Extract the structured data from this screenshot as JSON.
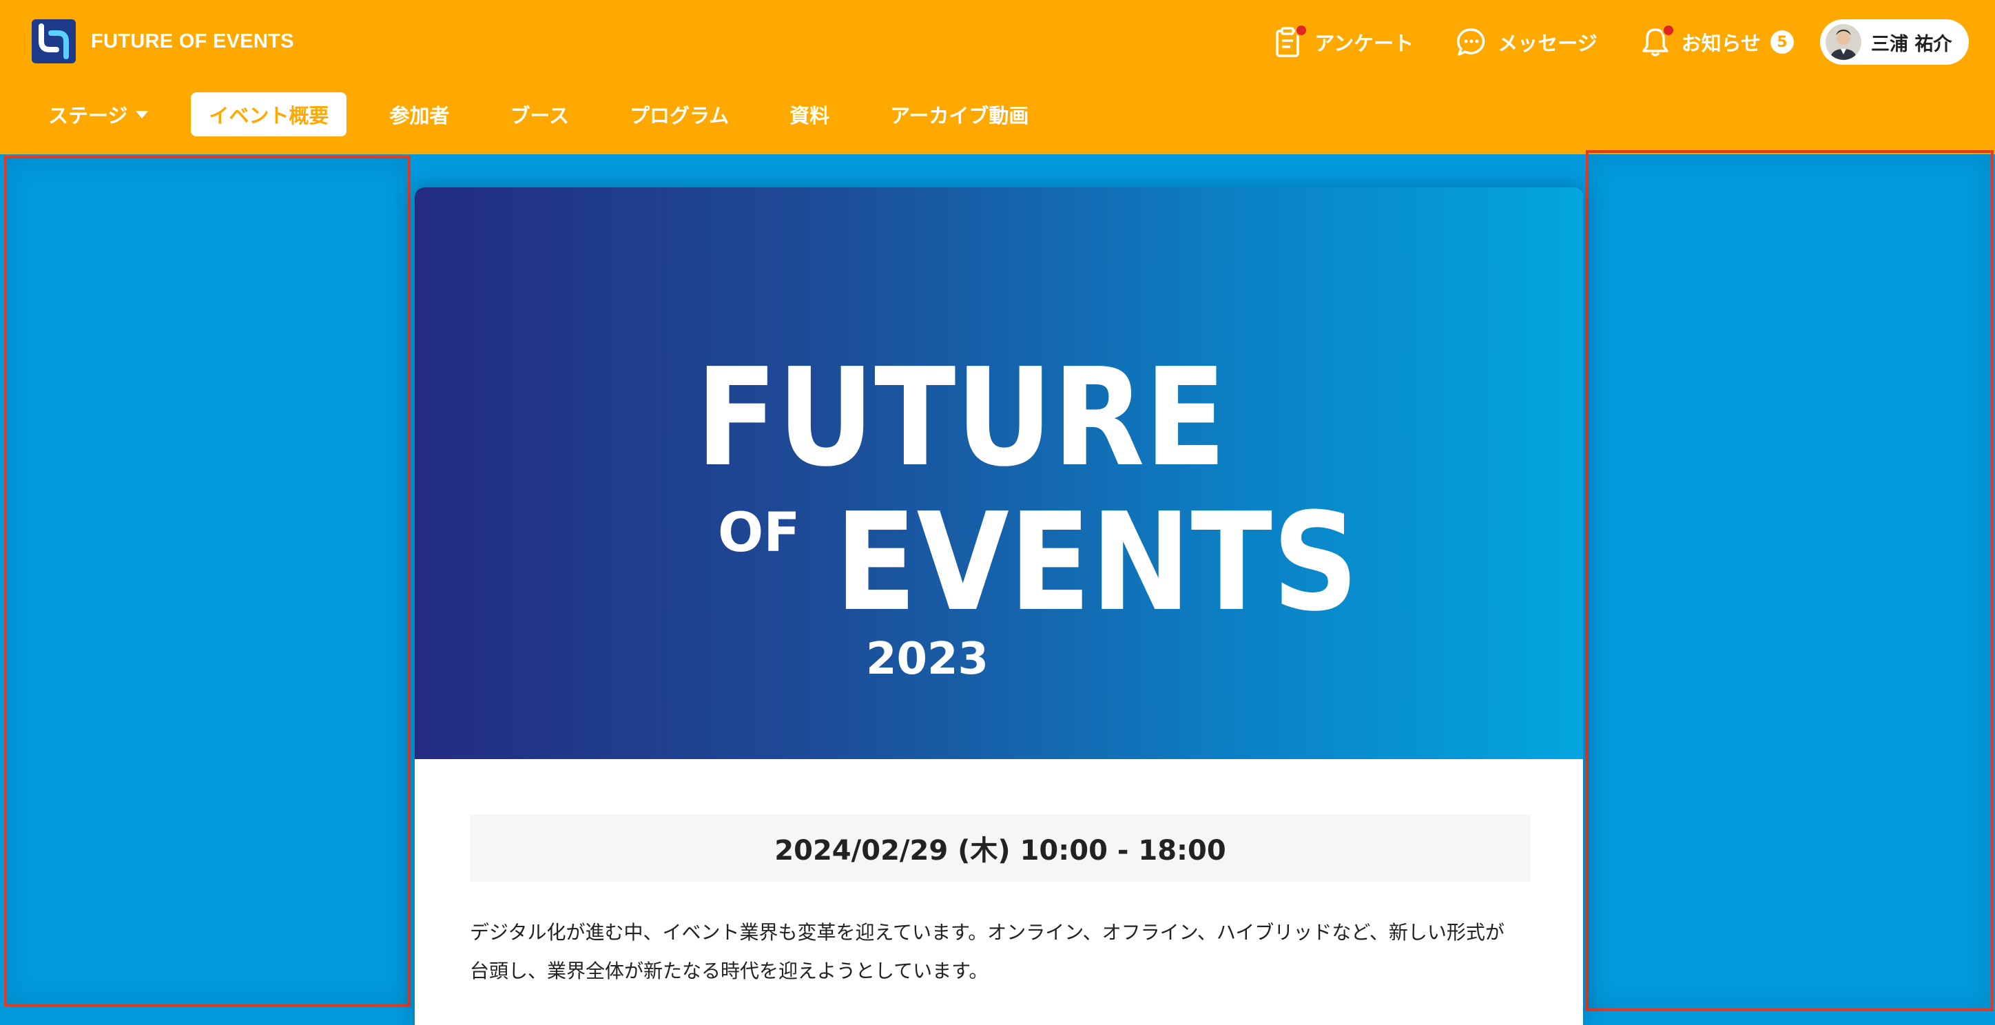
{
  "brand": {
    "name": "FUTURE OF EVENTS",
    "accent_color": "#ffa800"
  },
  "top_actions": {
    "survey": {
      "label": "アンケート",
      "icon": "clipboard-icon",
      "has_alert": true
    },
    "messages": {
      "label": "メッセージ",
      "icon": "chat-bubble-icon"
    },
    "notifications": {
      "label": "お知らせ",
      "icon": "bell-icon",
      "count": "5",
      "has_alert": true
    }
  },
  "user": {
    "name": "三浦 祐介"
  },
  "nav": {
    "items": [
      {
        "label": "ステージ",
        "has_dropdown": true,
        "active": false
      },
      {
        "label": "イベント概要",
        "active": true
      },
      {
        "label": "参加者",
        "active": false
      },
      {
        "label": "ブース",
        "active": false
      },
      {
        "label": "プログラム",
        "active": false
      },
      {
        "label": "資料",
        "active": false
      },
      {
        "label": "アーカイブ動画",
        "active": false
      }
    ]
  },
  "event": {
    "banner": {
      "line1": "FUTURE",
      "of": "OF",
      "line2": "EVENTS",
      "year": "2023"
    },
    "datetime": "2024/02/29 (木) 10:00 - 18:00",
    "description_line1": "デジタル化が進む中、イベント業界も変革を迎えています。オンライン、オフライン、ハイブリッドなど、新しい形式が",
    "description_line2": "台頭し、業界全体が新たなる時代を迎えようとしています。"
  },
  "colors": {
    "stage_background": "#0299dd",
    "highlight_border": "#e23b24",
    "banner_gradient": [
      "#232c80",
      "#1d4c98",
      "#0b82c6",
      "#03a6df"
    ]
  }
}
